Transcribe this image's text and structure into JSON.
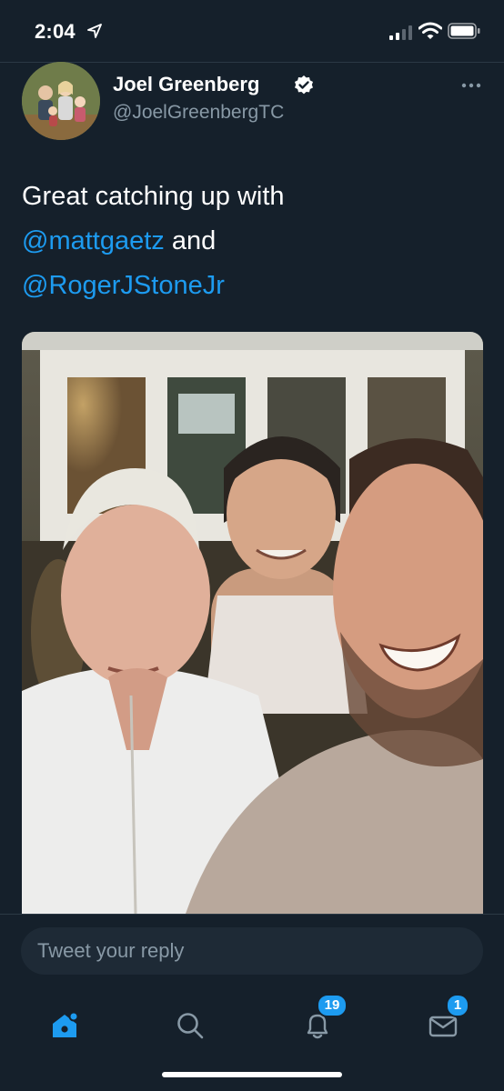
{
  "status": {
    "time": "2:04"
  },
  "tweet": {
    "display_name": "Joel Greenberg",
    "handle": "@JoelGreenbergTC",
    "text_plain_1": "Great catching up with",
    "mention_1": "@mattgaetz",
    "text_plain_2": " and",
    "mention_2": "@RogerJStoneJr"
  },
  "reply": {
    "placeholder": "Tweet your reply"
  },
  "tabs": {
    "notifications_badge": "19",
    "messages_badge": "1"
  },
  "colors": {
    "accent": "#1d9bf0",
    "background": "#15202b",
    "secondary_text": "#8899a6"
  },
  "icons": [
    "location-arrow-icon",
    "signal-icon",
    "wifi-icon",
    "battery-icon",
    "verified-icon",
    "more-icon",
    "home-icon",
    "search-icon",
    "bell-icon",
    "mail-icon"
  ]
}
